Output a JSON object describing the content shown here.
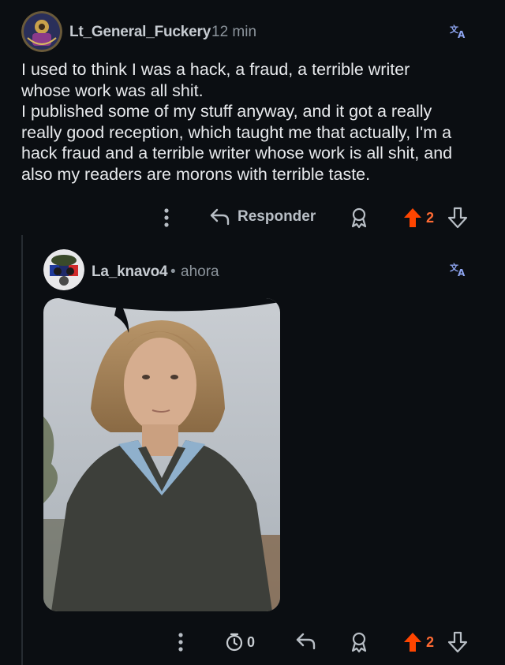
{
  "comment": {
    "username": "Lt_General_Fuckery",
    "time": "12 min",
    "translate_icon": "translate-icon",
    "body": "I used to think I was a hack, a fraud, a terrible writer\nwhose work was all shit.\nI published some of my stuff anyway, and it got a really\nreally good reception, which taught me that actually, I'm a\nhack fraud and a terrible writer whose work is all shit, and\nalso my readers are morons with terrible taste.",
    "actions": {
      "more_icon": "more-vertical-icon",
      "reply_label": "Responder",
      "award_icon": "award-icon",
      "upvote_icon": "upvote-icon",
      "score": "2",
      "downvote_icon": "downvote-icon"
    }
  },
  "reply": {
    "username": "La_knavo4",
    "separator": "•",
    "time": "ahora",
    "translate_icon": "translate-icon",
    "image": "photo",
    "actions": {
      "more_icon": "more-vertical-icon",
      "timer_icon": "timer-icon",
      "timer_count": "0",
      "reply_icon": "reply-icon",
      "award_icon": "award-icon",
      "upvote_icon": "upvote-icon",
      "score": "2",
      "downvote_icon": "downvote-icon"
    }
  },
  "colors": {
    "background": "#0b0e12",
    "upvote_active": "#ff4500",
    "translate": "#8fa6f2"
  }
}
